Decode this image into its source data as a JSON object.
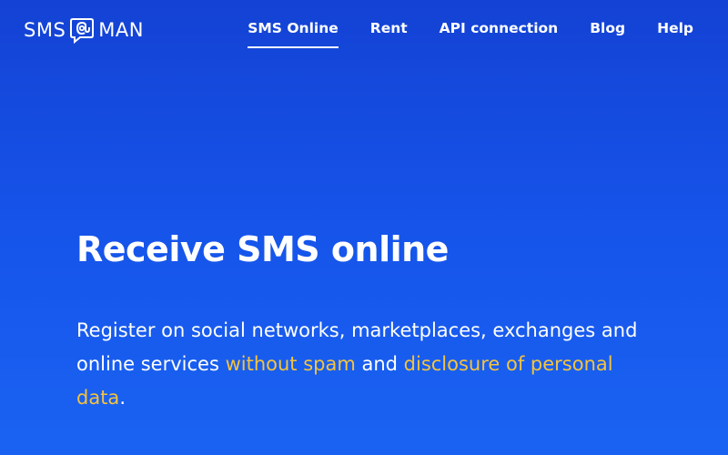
{
  "header": {
    "logo": {
      "left": "SMS",
      "right": "MAN"
    },
    "nav": [
      {
        "label": "SMS Online",
        "active": true
      },
      {
        "label": "Rent"
      },
      {
        "label": "API connection"
      },
      {
        "label": "Blog"
      },
      {
        "label": "Help"
      }
    ]
  },
  "hero": {
    "title": "Receive SMS online",
    "text_part1": "Register on social networks, marketplaces, exchanges and online services ",
    "highlight1": "without spam",
    "text_part2": " and ",
    "highlight2": "disclosure of personal data",
    "text_part3": "."
  },
  "colors": {
    "background": "#1654ea",
    "highlight": "#f4c33d",
    "text": "#ffffff"
  },
  "icons": {
    "logo_mark": "speech-bubble-at-icon"
  }
}
